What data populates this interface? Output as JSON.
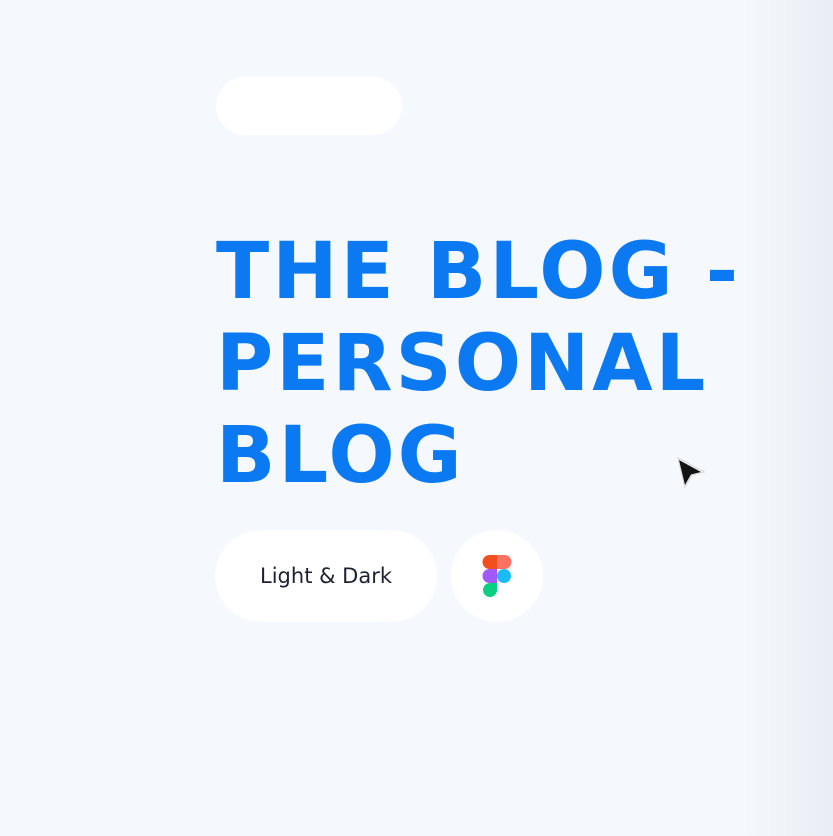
{
  "headline": {
    "line1": "THE BLOG -",
    "line2": "PERSONAL",
    "line3": "BLOG"
  },
  "theme_pill": {
    "label": "Light & Dark"
  },
  "icons": {
    "figma": "figma-icon",
    "cursor": "mouse-pointer-icon"
  },
  "colors": {
    "accent": "#0a79f2",
    "background": "#f5f8fc",
    "pill": "#ffffff",
    "text": "#1d2233",
    "figma_red": "#f24e1e",
    "figma_orange": "#ff7262",
    "figma_purple": "#a259ff",
    "figma_blue": "#1abcfe",
    "figma_green": "#0acf83"
  }
}
